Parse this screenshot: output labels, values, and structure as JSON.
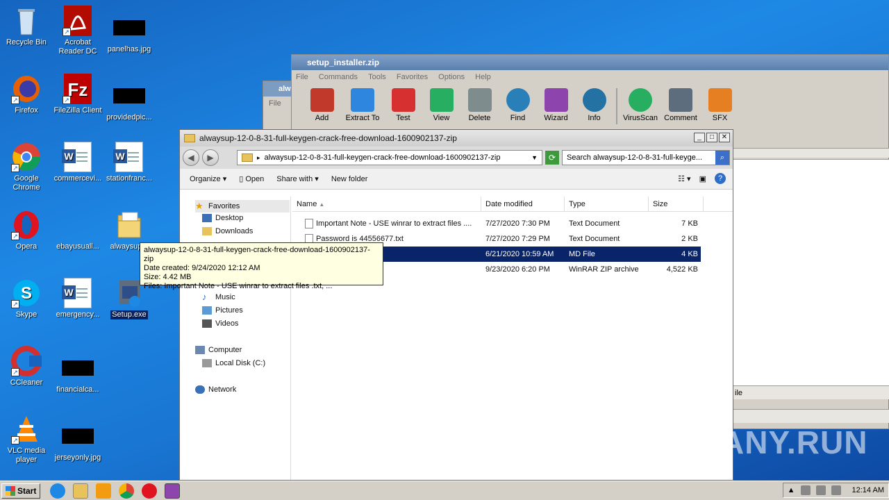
{
  "desktop": {
    "icons": [
      {
        "label": "Recycle Bin"
      },
      {
        "label": "Acrobat Reader DC"
      },
      {
        "label": "panelhas.jpg"
      },
      {
        "label": "Firefox"
      },
      {
        "label": "FileZilla Client"
      },
      {
        "label": "providedpic..."
      },
      {
        "label": "Google Chrome"
      },
      {
        "label": "commercevi..."
      },
      {
        "label": "stationfranc..."
      },
      {
        "label": "Opera"
      },
      {
        "label": "ebayusuall..."
      },
      {
        "label": "alwaysup..."
      },
      {
        "label": "Skype"
      },
      {
        "label": "emergency..."
      },
      {
        "label": "Setup.exe"
      },
      {
        "label": "CCleaner"
      },
      {
        "label": "financialca..."
      },
      {
        "label": "VLC media player"
      },
      {
        "label": "jerseyonly.jpg"
      }
    ]
  },
  "winrar": {
    "title": "setup_installer.zip",
    "menu": [
      "File",
      "Commands",
      "Tools",
      "Favorites",
      "Options",
      "Help"
    ],
    "toolbar": [
      {
        "label": "Add",
        "color": "#c0392b"
      },
      {
        "label": "Extract To",
        "color": "#2e86de"
      },
      {
        "label": "Test",
        "color": "#d63031"
      },
      {
        "label": "View",
        "color": "#27ae60"
      },
      {
        "label": "Delete",
        "color": "#7f8c8d"
      },
      {
        "label": "Find",
        "color": "#2980b9"
      },
      {
        "label": "Wizard",
        "color": "#8e44ad"
      },
      {
        "label": "Info",
        "color": "#2471a3"
      },
      {
        "label": "VirusScan",
        "color": "#27ae60"
      },
      {
        "label": "Comment",
        "color": "#5d6d7e"
      },
      {
        "label": "SFX",
        "color": "#e67e22"
      }
    ],
    "status_fragment": "ile"
  },
  "behind_window": {
    "title": "alw",
    "menu_file": "File"
  },
  "explorer": {
    "title": "alwaysup-12-0-8-31-full-keygen-crack-free-download-1600902137-zip",
    "address": "alwaysup-12-0-8-31-full-keygen-crack-free-download-1600902137-zip",
    "search_placeholder": "Search alwaysup-12-0-8-31-full-keyge...",
    "commands": {
      "organize": "Organize",
      "open": "Open",
      "share_with": "Share with",
      "new_folder": "New folder"
    },
    "nav": {
      "favorites": "Favorites",
      "desktop": "Desktop",
      "downloads": "Downloads",
      "music": "Music",
      "pictures": "Pictures",
      "videos": "Videos",
      "computer": "Computer",
      "local_disk": "Local Disk (C:)",
      "network": "Network"
    },
    "columns": {
      "name": "Name",
      "date": "Date modified",
      "type": "Type",
      "size": "Size"
    },
    "files": [
      {
        "name": "Important Note - USE winrar to extract files ....",
        "date": "7/27/2020 7:30 PM",
        "type": "Text Document",
        "size": "7 KB"
      },
      {
        "name": "Password is 44556677.txt",
        "date": "7/27/2020 7:29 PM",
        "type": "Text Document",
        "size": "2 KB"
      },
      {
        "name": "",
        "date": "6/21/2020 10:59 AM",
        "type": "MD File",
        "size": "4 KB"
      },
      {
        "name": "",
        "date": "9/23/2020 6:20 PM",
        "type": "WinRAR ZIP archive",
        "size": "4,522 KB"
      }
    ]
  },
  "tooltip": {
    "line1": "alwaysup-12-0-8-31-full-keygen-crack-free-download-1600902137-zip",
    "line2": "Date created: 9/24/2020 12:12 AM",
    "line3": "Size: 4.42 MB",
    "line4": "Files: Important Note - USE winrar to extract files .txt, ..."
  },
  "taskbar": {
    "start": "Start",
    "clock": "12:14 AM"
  },
  "watermark": "ANY.RUN"
}
